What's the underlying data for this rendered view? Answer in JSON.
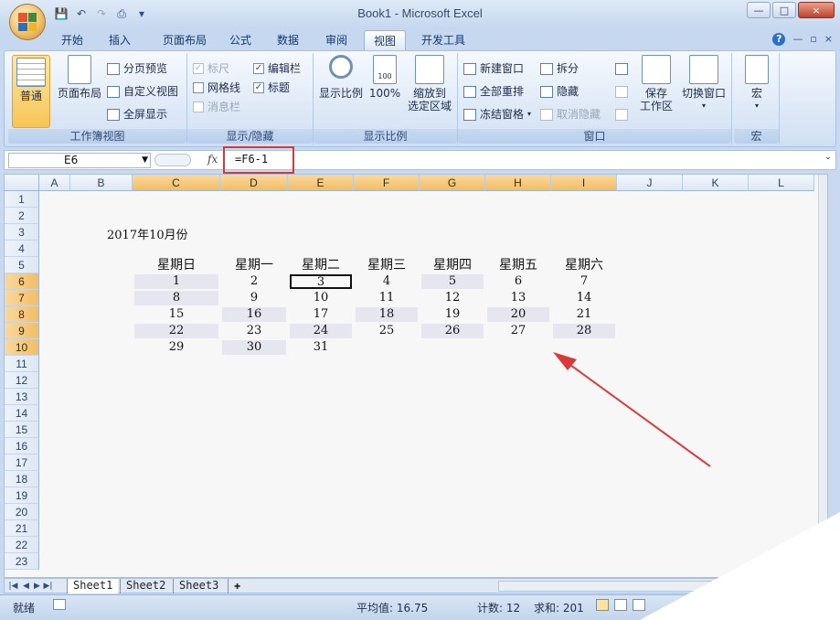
{
  "window": {
    "title": "Book1 - Microsoft Excel",
    "controls": [
      "—",
      "□",
      "×"
    ]
  },
  "quick_access": {
    "icons": [
      "save-icon",
      "undo-icon",
      "redo-icon",
      "print-preview-icon",
      "customize-icon"
    ]
  },
  "tabs": [
    {
      "label": "开始"
    },
    {
      "label": "插入"
    },
    {
      "label": "页面布局"
    },
    {
      "label": "公式"
    },
    {
      "label": "数据"
    },
    {
      "label": "审阅"
    },
    {
      "label": "视图"
    },
    {
      "label": "开发工具"
    }
  ],
  "active_tab": "视图",
  "ribbon_right": {
    "help": "?",
    "min": "—",
    "restore": "▫",
    "close": "×"
  },
  "ribbon": {
    "workbook_views": {
      "label": "工作簿视图",
      "normal": "普通",
      "page_layout": "页面布局",
      "page_break_preview": "分页预览",
      "custom_views": "自定义视图",
      "full_screen": "全屏显示"
    },
    "show_hide": {
      "label": "显示/隐藏",
      "ruler": "标尺",
      "gridlines": "网格线",
      "message_bar": "消息栏",
      "formula_bar": "编辑栏",
      "headings": "标题"
    },
    "zoom": {
      "label": "显示比例",
      "zoom": "显示比例",
      "zoom_100": "100%",
      "zoom_to_selection_1": "缩放到",
      "zoom_to_selection_2": "选定区域",
      "icon_text": "100"
    },
    "window": {
      "label": "窗口",
      "new_window": "新建窗口",
      "arrange_all": "全部重排",
      "freeze_panes": "冻结窗格",
      "split": "拆分",
      "hide": "隐藏",
      "unhide": "取消隐藏",
      "save_workspace_1": "保存",
      "save_workspace_2": "工作区",
      "switch_windows": "切换窗口"
    },
    "macros": {
      "label": "宏",
      "macros": "宏"
    }
  },
  "formula_bar": {
    "name_box": "E6",
    "fx": "fx",
    "formula": "=F6-1"
  },
  "columns": [
    "A",
    "B",
    "C",
    "D",
    "E",
    "F",
    "G",
    "H",
    "I",
    "J",
    "K",
    "L"
  ],
  "rows": [
    "1",
    "2",
    "3",
    "4",
    "5",
    "6",
    "7",
    "8",
    "9",
    "10",
    "11",
    "12",
    "13",
    "14",
    "15",
    "16",
    "17",
    "18",
    "19",
    "20",
    "21",
    "22",
    "23"
  ],
  "sheet": {
    "title": "2017年10月份",
    "weekdays": [
      "星期日",
      "星期一",
      "星期二",
      "星期三",
      "星期四",
      "星期五",
      "星期六"
    ],
    "calendar": [
      [
        "1",
        "2",
        "3",
        "4",
        "5",
        "6",
        "7"
      ],
      [
        "8",
        "9",
        "10",
        "11",
        "12",
        "13",
        "14"
      ],
      [
        "15",
        "16",
        "17",
        "18",
        "19",
        "20",
        "21"
      ],
      [
        "22",
        "23",
        "24",
        "25",
        "26",
        "27",
        "28"
      ],
      [
        "29",
        "30",
        "31",
        "",
        "",
        "",
        ""
      ]
    ],
    "active_cell": "E6",
    "annotation_arrow_color": "#d83a3a"
  },
  "sheet_tabs": [
    "Sheet1",
    "Sheet2",
    "Sheet3"
  ],
  "status_bar": {
    "ready": "就绪",
    "average": "平均值: 16.75",
    "count": "计数: 12",
    "sum": "求和: 201"
  },
  "colors": {
    "accent": "#f3bd63",
    "ribbon": "#dbe7f6",
    "highlight_box": "#d33a3a"
  }
}
